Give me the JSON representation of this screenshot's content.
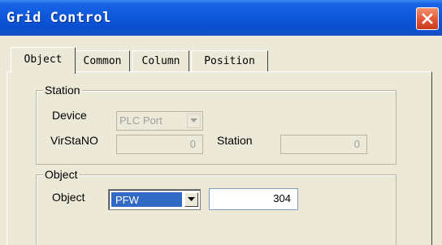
{
  "window": {
    "title": "Grid Control",
    "titlebar_color": "#0a4fcf",
    "close_icon": "close-icon"
  },
  "tabs": [
    {
      "label": "Object",
      "active": true
    },
    {
      "label": "Common",
      "active": false
    },
    {
      "label": "Column",
      "active": false
    },
    {
      "label": "Position",
      "active": false
    }
  ],
  "station_group": {
    "legend": "Station",
    "device_label": "Device",
    "device_value": "PLC Port",
    "virstano_label": "VirStaNO",
    "virstano_value": "0",
    "station_label": "Station",
    "station_value": "0"
  },
  "object_group": {
    "legend": "Object",
    "object_label": "Object",
    "object_type_value": "PFW",
    "address_value": "304",
    "selection_color": "#316ac5"
  }
}
